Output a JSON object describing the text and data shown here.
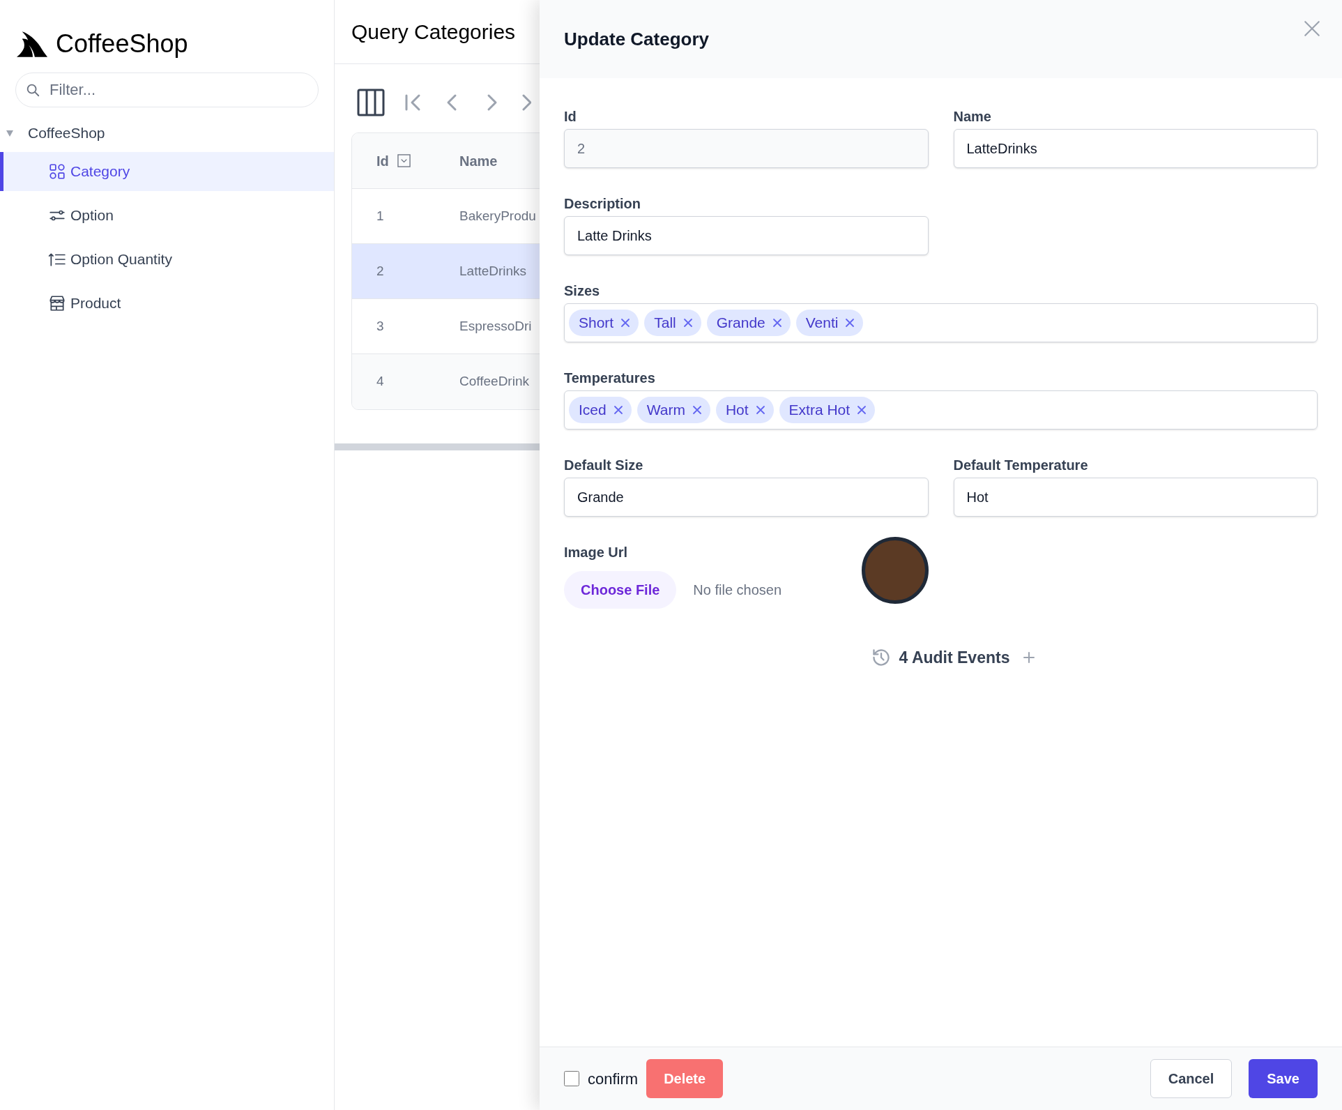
{
  "sidebar": {
    "app_title": "CoffeeShop",
    "filter": {
      "placeholder": "Filter..."
    },
    "tree": [
      {
        "label": "CoffeeShop",
        "expanded": true,
        "children": [
          {
            "label": "Category",
            "selected": true
          },
          {
            "label": "Option",
            "selected": false
          },
          {
            "label": "Option Quantity",
            "selected": false
          },
          {
            "label": "Product",
            "selected": false
          }
        ]
      }
    ]
  },
  "list_view": {
    "title": "Query Categories",
    "columns": [
      "Id",
      "Name"
    ],
    "rows": [
      {
        "id": "1",
        "name": "BakeryProdu",
        "selected": false
      },
      {
        "id": "2",
        "name": "LatteDrinks",
        "selected": true
      },
      {
        "id": "3",
        "name": "EspressoDri",
        "selected": false
      },
      {
        "id": "4",
        "name": "CoffeeDrink",
        "selected": false
      }
    ]
  },
  "dialog": {
    "title": "Update Category",
    "fields": [
      {
        "kind": "text",
        "label": "Id",
        "value": "2",
        "disabled": true
      },
      {
        "kind": "text",
        "label": "Name",
        "value": "LatteDrinks",
        "disabled": false
      },
      {
        "kind": "text",
        "label": "Description",
        "value": "Latte Drinks",
        "disabled": false
      },
      {
        "kind": "tags",
        "label": "Sizes",
        "tags": [
          "Short",
          "Tall",
          "Grande",
          "Venti"
        ]
      },
      {
        "kind": "tags",
        "label": "Temperatures",
        "tags": [
          "Iced",
          "Warm",
          "Hot",
          "Extra Hot"
        ]
      },
      {
        "kind": "text",
        "label": "Default Size",
        "value": "Grande",
        "disabled": false
      },
      {
        "kind": "text",
        "label": "Default Temperature",
        "value": "Hot",
        "disabled": false
      },
      {
        "kind": "file",
        "label": "Image Url",
        "button": "Choose File",
        "status": "No file chosen"
      }
    ],
    "audit": "4 Audit Events",
    "confirm": {
      "label": "confirm",
      "checked": false
    },
    "delete": "Delete",
    "cancel": "Cancel",
    "save": "Save"
  }
}
